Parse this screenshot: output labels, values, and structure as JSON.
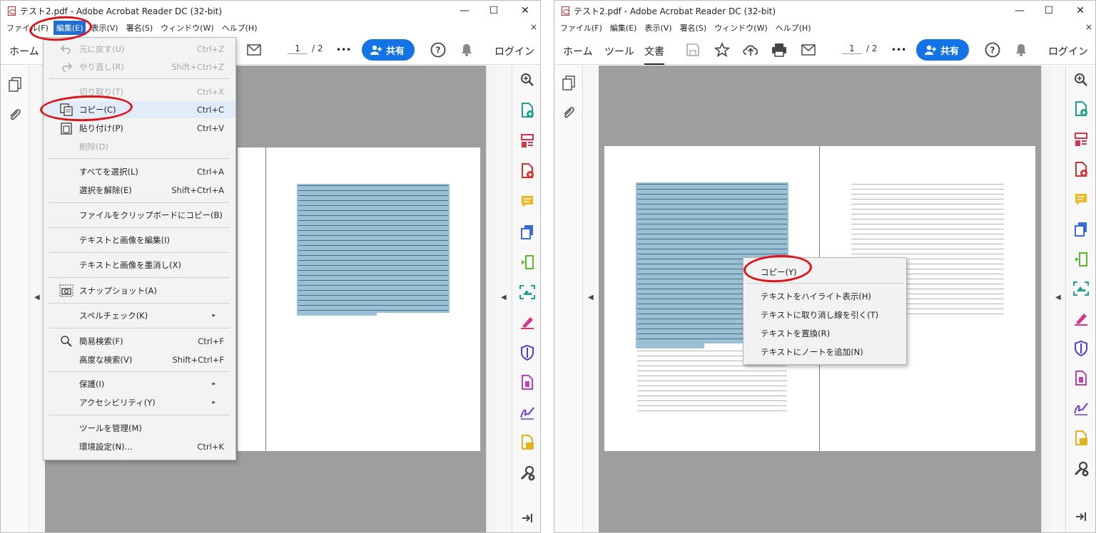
{
  "app": {
    "window_title": "テスト2.pdf - Adobe Acrobat Reader DC (32-bit)",
    "minimize": "—",
    "maximize": "☐",
    "close": "✕",
    "menu_close": "×"
  },
  "menubar": {
    "file": "ファイル(F)",
    "edit": "編集(E)",
    "view": "表示(V)",
    "sign": "署名(S)",
    "window": "ウィンドウ(W)",
    "help": "ヘルプ(H)"
  },
  "menubar_left": {
    "file": "ファイル(F)",
    "edit": "編集(E)",
    "view": "表示(V)",
    "sign": "署名(S)",
    "window": "ウィンドウ(W)",
    "help": "ヘルプ(H)"
  },
  "toolbar": {
    "home": "ホーム",
    "tools": "ツール",
    "document": "文書",
    "page_current": "1",
    "page_total": "/ 2",
    "more": "•••",
    "share": "共有",
    "help": "?",
    "login": "ログイン"
  },
  "edit_menu": {
    "items": [
      {
        "label": "元に戻す(U)",
        "shortcut": "Ctrl+Z",
        "disabled": true,
        "icon": "undo-icon"
      },
      {
        "label": "やり直し(R)",
        "shortcut": "Shift+Ctrl+Z",
        "disabled": true,
        "icon": "redo-icon"
      },
      {
        "label": "切り取り(T)",
        "shortcut": "Ctrl+X",
        "disabled": true
      },
      {
        "label": "コピー(C)",
        "shortcut": "Ctrl+C",
        "disabled": false,
        "icon": "copy-icon",
        "highlighted": true
      },
      {
        "label": "貼り付け(P)",
        "shortcut": "Ctrl+V",
        "disabled": false,
        "icon": "paste-icon"
      },
      {
        "label": "削除(D)",
        "shortcut": "",
        "disabled": true
      },
      {
        "label": "すべてを選択(L)",
        "shortcut": "Ctrl+A"
      },
      {
        "label": "選択を解除(E)",
        "shortcut": "Shift+Ctrl+A"
      },
      {
        "label": "ファイルをクリップボードにコピー(B)",
        "shortcut": ""
      },
      {
        "label": "テキストと画像を編集(I)",
        "shortcut": ""
      },
      {
        "label": "テキストと画像を墨消し(X)",
        "shortcut": ""
      },
      {
        "label": "スナップショット(A)",
        "shortcut": "",
        "icon": "camera-icon"
      },
      {
        "label": "スペルチェック(K)",
        "shortcut": "",
        "submenu": true
      },
      {
        "label": "簡易検索(F)",
        "shortcut": "Ctrl+F",
        "icon": "search-icon"
      },
      {
        "label": "高度な検索(V)",
        "shortcut": "Shift+Ctrl+F"
      },
      {
        "label": "保護(I)",
        "shortcut": "",
        "submenu": true
      },
      {
        "label": "アクセシビリティ(Y)",
        "shortcut": "",
        "submenu": true
      },
      {
        "label": "ツールを管理(M)",
        "shortcut": ""
      },
      {
        "label": "環境設定(N)...",
        "shortcut": "Ctrl+K"
      }
    ]
  },
  "context_menu": {
    "items": [
      {
        "label": "コピー(Y)"
      },
      {
        "label": "テキストをハイライト表示(H)"
      },
      {
        "label": "テキストに取り消し線を引く(T)"
      },
      {
        "label": "テキストを置換(R)"
      },
      {
        "label": "テキストにノートを追加(N)"
      }
    ]
  },
  "colors": {
    "accent_blue": "#1473e6",
    "annotation_red": "#e0131a",
    "selection": "#9ac0d6",
    "viewer_bg": "#9e9e9e"
  },
  "glyphs": {
    "arrow_left": "◀",
    "submenu": "▸",
    "zoom": "⊕"
  }
}
